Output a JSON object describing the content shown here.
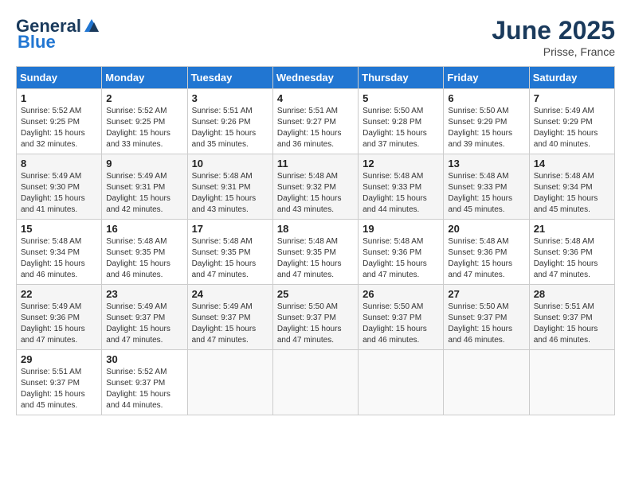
{
  "header": {
    "logo_general": "General",
    "logo_blue": "Blue",
    "month_title": "June 2025",
    "location": "Prisse, France"
  },
  "days_of_week": [
    "Sunday",
    "Monday",
    "Tuesday",
    "Wednesday",
    "Thursday",
    "Friday",
    "Saturday"
  ],
  "weeks": [
    [
      {
        "day": "1",
        "info": "Sunrise: 5:52 AM\nSunset: 9:25 PM\nDaylight: 15 hours\nand 32 minutes."
      },
      {
        "day": "2",
        "info": "Sunrise: 5:52 AM\nSunset: 9:25 PM\nDaylight: 15 hours\nand 33 minutes."
      },
      {
        "day": "3",
        "info": "Sunrise: 5:51 AM\nSunset: 9:26 PM\nDaylight: 15 hours\nand 35 minutes."
      },
      {
        "day": "4",
        "info": "Sunrise: 5:51 AM\nSunset: 9:27 PM\nDaylight: 15 hours\nand 36 minutes."
      },
      {
        "day": "5",
        "info": "Sunrise: 5:50 AM\nSunset: 9:28 PM\nDaylight: 15 hours\nand 37 minutes."
      },
      {
        "day": "6",
        "info": "Sunrise: 5:50 AM\nSunset: 9:29 PM\nDaylight: 15 hours\nand 39 minutes."
      },
      {
        "day": "7",
        "info": "Sunrise: 5:49 AM\nSunset: 9:29 PM\nDaylight: 15 hours\nand 40 minutes."
      }
    ],
    [
      {
        "day": "8",
        "info": "Sunrise: 5:49 AM\nSunset: 9:30 PM\nDaylight: 15 hours\nand 41 minutes."
      },
      {
        "day": "9",
        "info": "Sunrise: 5:49 AM\nSunset: 9:31 PM\nDaylight: 15 hours\nand 42 minutes."
      },
      {
        "day": "10",
        "info": "Sunrise: 5:48 AM\nSunset: 9:31 PM\nDaylight: 15 hours\nand 43 minutes."
      },
      {
        "day": "11",
        "info": "Sunrise: 5:48 AM\nSunset: 9:32 PM\nDaylight: 15 hours\nand 43 minutes."
      },
      {
        "day": "12",
        "info": "Sunrise: 5:48 AM\nSunset: 9:33 PM\nDaylight: 15 hours\nand 44 minutes."
      },
      {
        "day": "13",
        "info": "Sunrise: 5:48 AM\nSunset: 9:33 PM\nDaylight: 15 hours\nand 45 minutes."
      },
      {
        "day": "14",
        "info": "Sunrise: 5:48 AM\nSunset: 9:34 PM\nDaylight: 15 hours\nand 45 minutes."
      }
    ],
    [
      {
        "day": "15",
        "info": "Sunrise: 5:48 AM\nSunset: 9:34 PM\nDaylight: 15 hours\nand 46 minutes."
      },
      {
        "day": "16",
        "info": "Sunrise: 5:48 AM\nSunset: 9:35 PM\nDaylight: 15 hours\nand 46 minutes."
      },
      {
        "day": "17",
        "info": "Sunrise: 5:48 AM\nSunset: 9:35 PM\nDaylight: 15 hours\nand 47 minutes."
      },
      {
        "day": "18",
        "info": "Sunrise: 5:48 AM\nSunset: 9:35 PM\nDaylight: 15 hours\nand 47 minutes."
      },
      {
        "day": "19",
        "info": "Sunrise: 5:48 AM\nSunset: 9:36 PM\nDaylight: 15 hours\nand 47 minutes."
      },
      {
        "day": "20",
        "info": "Sunrise: 5:48 AM\nSunset: 9:36 PM\nDaylight: 15 hours\nand 47 minutes."
      },
      {
        "day": "21",
        "info": "Sunrise: 5:48 AM\nSunset: 9:36 PM\nDaylight: 15 hours\nand 47 minutes."
      }
    ],
    [
      {
        "day": "22",
        "info": "Sunrise: 5:49 AM\nSunset: 9:36 PM\nDaylight: 15 hours\nand 47 minutes."
      },
      {
        "day": "23",
        "info": "Sunrise: 5:49 AM\nSunset: 9:37 PM\nDaylight: 15 hours\nand 47 minutes."
      },
      {
        "day": "24",
        "info": "Sunrise: 5:49 AM\nSunset: 9:37 PM\nDaylight: 15 hours\nand 47 minutes."
      },
      {
        "day": "25",
        "info": "Sunrise: 5:50 AM\nSunset: 9:37 PM\nDaylight: 15 hours\nand 47 minutes."
      },
      {
        "day": "26",
        "info": "Sunrise: 5:50 AM\nSunset: 9:37 PM\nDaylight: 15 hours\nand 46 minutes."
      },
      {
        "day": "27",
        "info": "Sunrise: 5:50 AM\nSunset: 9:37 PM\nDaylight: 15 hours\nand 46 minutes."
      },
      {
        "day": "28",
        "info": "Sunrise: 5:51 AM\nSunset: 9:37 PM\nDaylight: 15 hours\nand 46 minutes."
      }
    ],
    [
      {
        "day": "29",
        "info": "Sunrise: 5:51 AM\nSunset: 9:37 PM\nDaylight: 15 hours\nand 45 minutes."
      },
      {
        "day": "30",
        "info": "Sunrise: 5:52 AM\nSunset: 9:37 PM\nDaylight: 15 hours\nand 44 minutes."
      },
      {
        "day": "",
        "info": ""
      },
      {
        "day": "",
        "info": ""
      },
      {
        "day": "",
        "info": ""
      },
      {
        "day": "",
        "info": ""
      },
      {
        "day": "",
        "info": ""
      }
    ]
  ]
}
